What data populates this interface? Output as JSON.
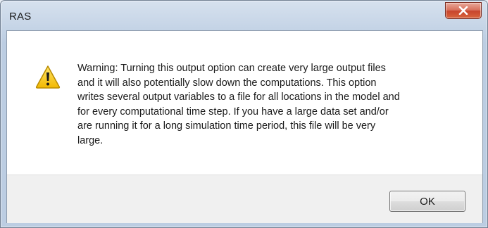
{
  "window": {
    "title": "RAS",
    "close_icon": "close-icon"
  },
  "dialog": {
    "icon": "warning-icon",
    "message": "Warning: Turning this output option can create very large output files\nand it will also potentially slow down the computations.  This option\nwrites several output variables to a file for all locations in the model and\nfor every computational time step.  If you have a large data set and/or\nare running it for a long simulation time period, this file will be very\nlarge."
  },
  "buttons": {
    "ok_label": "OK"
  },
  "colors": {
    "close_button": "#c8452c",
    "warning_yellow": "#f5c400",
    "titlebar": "#c9d7e8"
  }
}
